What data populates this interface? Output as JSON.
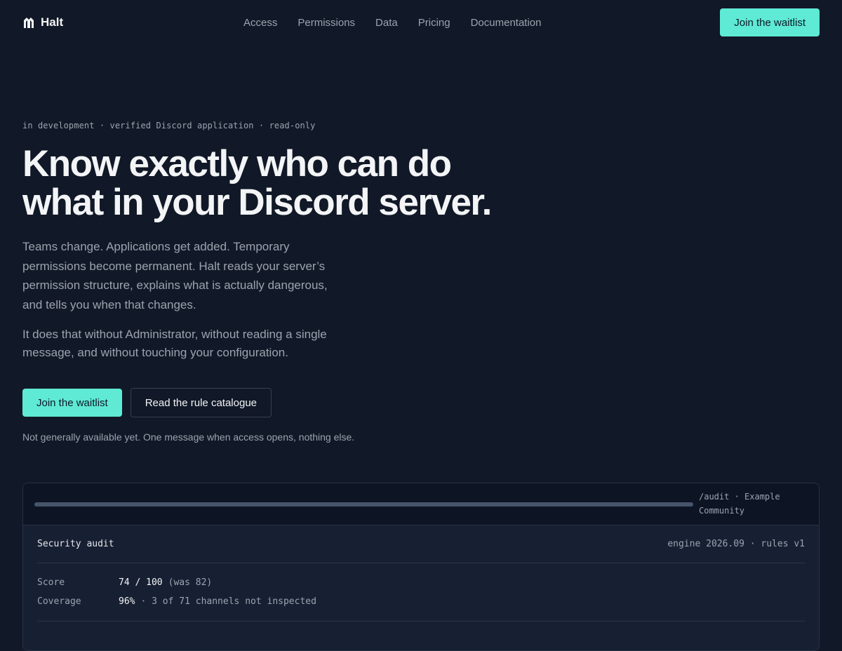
{
  "nav": {
    "brand": "Halt",
    "links": [
      "Access",
      "Permissions",
      "Data",
      "Pricing",
      "Documentation"
    ],
    "cta": "Join the waitlist"
  },
  "hero": {
    "eyebrow": "in development · verified Discord application · read-only",
    "headline": "Know exactly who can do what in your Discord server.",
    "lead": "Teams change. Applications get added. Temporary permissions become permanent. Halt reads your server’s permission structure, explains what is actually dangerous, and tells you when that changes.",
    "lead2": "It does that without Administrator, without reading a single message, and without touching your configuration.",
    "primary_cta": "Join the waitlist",
    "secondary_cta": "Read the rule catalogue",
    "fineprint": "Not generally available yet. One message when access opens, nothing else."
  },
  "panel": {
    "path": "/audit · Example Community",
    "title": "Security audit",
    "engine": "engine 2026.09 · rules v1",
    "score_label": "Score",
    "score_value": "74 / 100",
    "score_previous": "(was 82)",
    "coverage_label": "Coverage",
    "coverage_value": "96%",
    "coverage_detail": "· 3 of 71 channels not inspected"
  },
  "colors": {
    "background": "#111827",
    "accent": "#5eead4",
    "panel": "#172033"
  }
}
